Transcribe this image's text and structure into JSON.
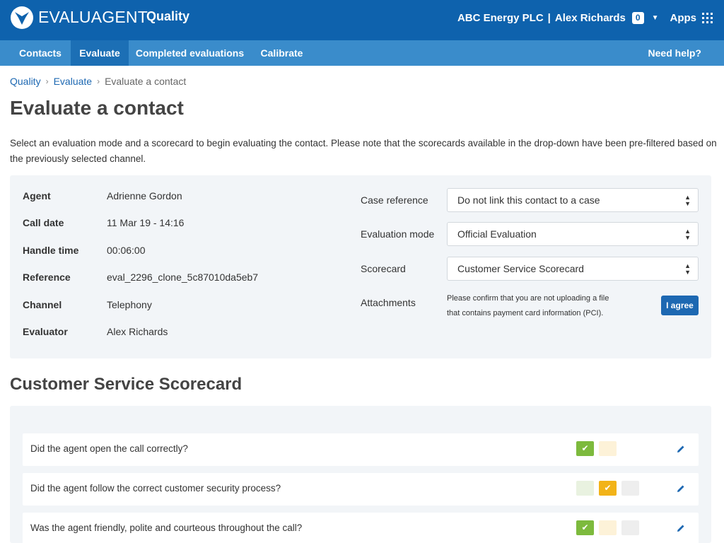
{
  "header": {
    "brand": "EVALUAGENT",
    "product": "Quality",
    "company": "ABC Energy PLC",
    "separator": "|",
    "user": "Alex Richards",
    "notifications": "0",
    "apps_label": "Apps",
    "icons": [
      "evaluagent-logo-icon",
      "chevron-down-icon",
      "apps-grid-icon"
    ],
    "color": "#0e62ad"
  },
  "nav": {
    "items": [
      {
        "label": "Contacts",
        "active": false
      },
      {
        "label": "Evaluate",
        "active": true
      },
      {
        "label": "Completed evaluations",
        "active": false
      },
      {
        "label": "Calibrate",
        "active": false
      }
    ],
    "help": "Need help?",
    "color": "#3a8ccb",
    "active_color": "#1c6fb5"
  },
  "breadcrumb": {
    "items": [
      "Quality",
      "Evaluate",
      "Evaluate a contact"
    ]
  },
  "page": {
    "title": "Evaluate a contact",
    "intro": "Select an evaluation mode and a scorecard to begin evaluating the contact. Please note that the scorecards available in the drop-down have been pre-filtered based on the previously selected channel."
  },
  "details": {
    "fields": [
      {
        "label": "Agent",
        "value": "Adrienne Gordon"
      },
      {
        "label": "Call date",
        "value": "11 Mar 19 - 14:16"
      },
      {
        "label": "Handle time",
        "value": "00:06:00"
      },
      {
        "label": "Reference",
        "value": "eval_2296_clone_5c87010da5eb7"
      },
      {
        "label": "Channel",
        "value": "Telephony"
      },
      {
        "label": "Evaluator",
        "value": "Alex Richards"
      }
    ]
  },
  "form": {
    "case_reference": {
      "label": "Case reference",
      "value": "Do not link this contact to a case"
    },
    "evaluation_mode": {
      "label": "Evaluation mode",
      "value": "Official Evaluation"
    },
    "scorecard": {
      "label": "Scorecard",
      "value": "Customer Service Scorecard"
    },
    "attachments": {
      "label": "Attachments",
      "note": "Please confirm that you are not uploading a file that contains payment card information (PCI).",
      "button": "I agree"
    }
  },
  "scorecard": {
    "title": "Customer Service Scorecard",
    "questions": [
      {
        "text": "Did the agent open the call correctly?",
        "answer": "pass"
      },
      {
        "text": "Did the agent follow the correct customer security process?",
        "answer": "partial"
      },
      {
        "text": "Was the agent friendly, polite and courteous throughout the call?",
        "answer": "pass"
      }
    ],
    "colors": {
      "pass": "#7dba3d",
      "partial": "#f2b318",
      "fail": "#eeeeee"
    }
  }
}
